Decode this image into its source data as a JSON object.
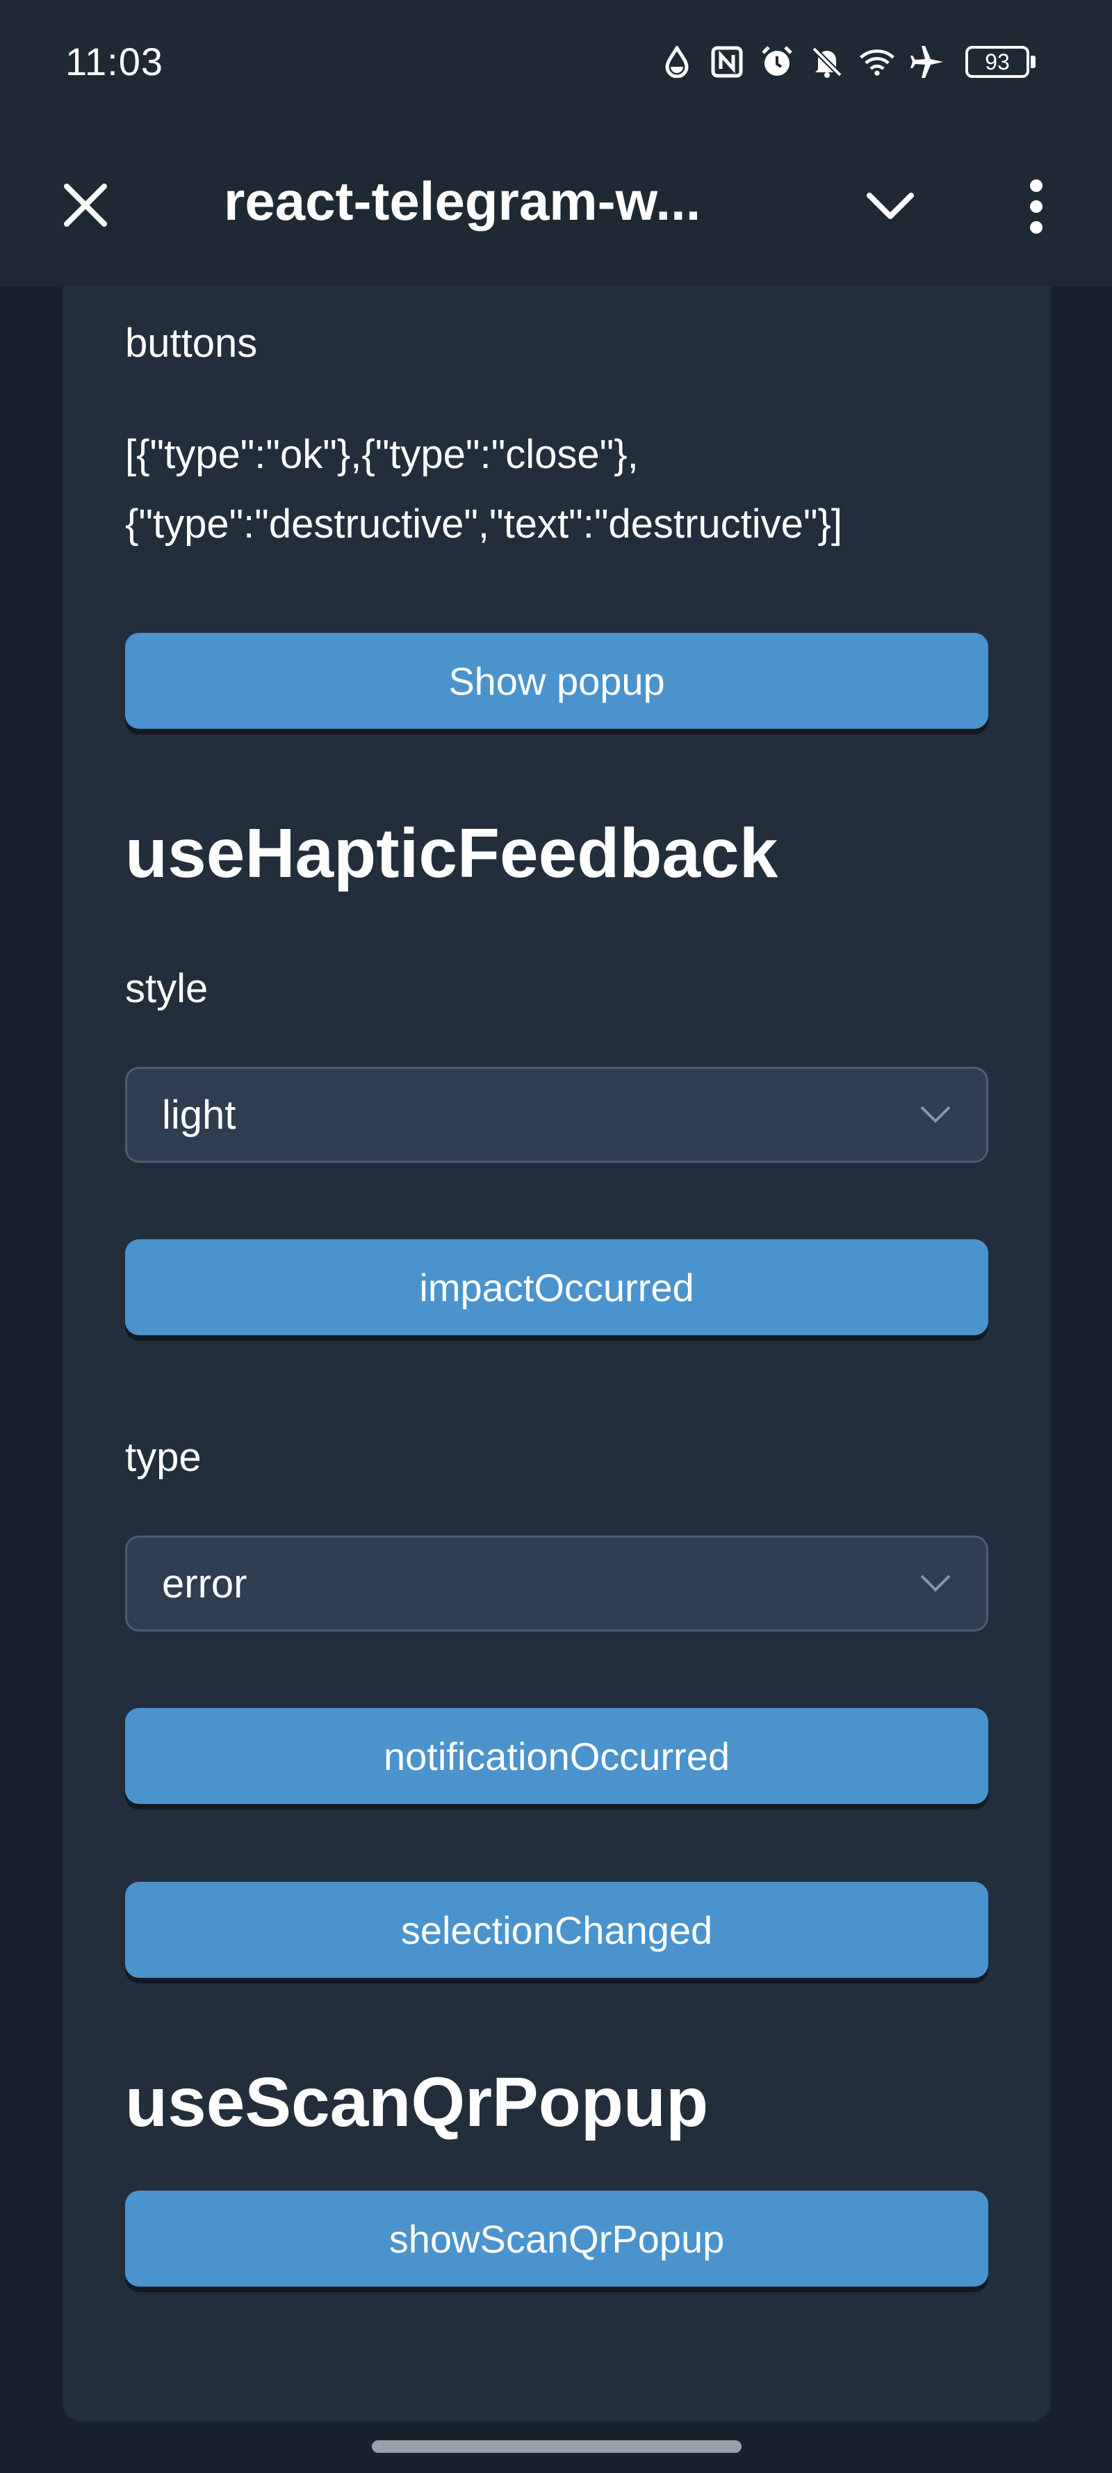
{
  "status_bar": {
    "time": "11:03",
    "battery": "93",
    "icons": [
      "water-drop-icon",
      "nfc-icon",
      "alarm-icon",
      "bell-off-icon",
      "wifi-icon",
      "airplane-icon"
    ]
  },
  "app_bar": {
    "title": "react-telegram-w...",
    "close_icon": "close-icon",
    "collapse_icon": "chevron-down-icon",
    "menu_icon": "more-vertical-icon"
  },
  "popup_section": {
    "buttons_label": "buttons",
    "buttons_value": "[{\"type\":\"ok\"},{\"type\":\"close\"},{\"type\":\"destructive\",\"text\":\"destructive\"}]",
    "show_popup_button": "Show popup"
  },
  "haptic_section": {
    "title": "useHapticFeedback",
    "style_label": "style",
    "style_value": "light",
    "impact_button": "impactOccurred",
    "type_label": "type",
    "type_value": "error",
    "notification_button": "notificationOccurred",
    "selection_button": "selectionChanged"
  },
  "qr_section": {
    "title": "useScanQrPopup",
    "show_button": "showScanQrPopup"
  },
  "colors": {
    "accent_button": "#4a93cd",
    "card_background": "#232e3c",
    "page_background": "#18222c",
    "header_background": "#1f2933",
    "select_background": "#2f3d51"
  }
}
